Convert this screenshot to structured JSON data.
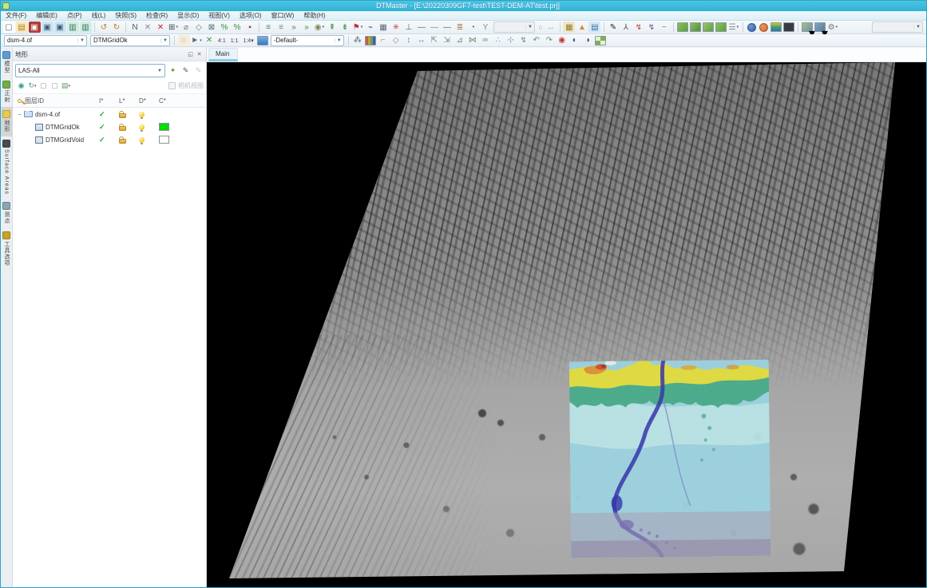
{
  "window": {
    "title": "DTMaster - [E:\\20220309GF7-test\\TEST-DEM-AT\\test.prj]"
  },
  "menus": [
    "文件(F)",
    "编辑(E)",
    "点(P)",
    "线(L)",
    "快照(S)",
    "检查(R)",
    "显示(D)",
    "视图(V)",
    "选项(O)",
    "窗口(W)",
    "帮助(H)"
  ],
  "toolbar1": {
    "icons": [
      {
        "n": "new-file-icon",
        "g": "▢",
        "c": "#666677",
        "bg": "#fdfdfd"
      },
      {
        "n": "open-folder-icon",
        "g": "▤",
        "c": "#a87f28",
        "bg": "#fbe9bc"
      },
      {
        "n": "save-icon",
        "g": "▣",
        "c": "#ffffff",
        "bg": "#b03a3a"
      },
      {
        "n": "copy-view-icon",
        "g": "▣",
        "c": "#33617f",
        "bg": "#cfe3f2"
      },
      {
        "n": "paste-view-icon",
        "g": "▣",
        "c": "#33617f",
        "bg": "#cfe3f2"
      },
      {
        "n": "load-image-icon",
        "g": "▥",
        "c": "#2f6f6f",
        "bg": "#d2eede"
      },
      {
        "n": "load-stereo-icon",
        "g": "▥",
        "c": "#2f6f6f",
        "bg": "#d2eede"
      },
      {
        "t": "sep"
      },
      {
        "n": "undo-icon",
        "g": "↺",
        "c": "#c07820"
      },
      {
        "n": "redo-icon",
        "g": "↻",
        "c": "#c07820"
      },
      {
        "t": "sep"
      },
      {
        "n": "draw-polyline-icon",
        "g": "N",
        "c": "#556"
      },
      {
        "n": "delete-icon",
        "g": "✕",
        "c": "#889"
      },
      {
        "n": "delete-all-icon",
        "g": "✕",
        "c": "#cc2020"
      },
      {
        "n": "grid-select-icon",
        "g": "⊞",
        "c": "#445",
        "dd": true
      },
      {
        "n": "eraser-icon",
        "g": "⌀",
        "c": "#777"
      },
      {
        "n": "clear-region-icon",
        "g": "◇",
        "c": "#777"
      },
      {
        "n": "fence-icon",
        "g": "⊠",
        "c": "#577"
      },
      {
        "n": "interpolate-icon",
        "g": "%",
        "c": "#3a8f3a"
      },
      {
        "n": "interpolate-all-icon",
        "g": "%",
        "c": "#3a8f3a"
      },
      {
        "n": "stop-icon",
        "g": "▪",
        "c": "#c03030"
      },
      {
        "t": "sep"
      },
      {
        "n": "layer-view-icon",
        "g": "≡",
        "c": "#3f7f7f"
      },
      {
        "n": "layer-view-2-icon",
        "g": "≡",
        "c": "#5f8f6f"
      },
      {
        "n": "run-filter-icon",
        "g": "»",
        "c": "#2f8f2f"
      },
      {
        "n": "run-filter-2-icon",
        "g": "»",
        "c": "#2f8f2f"
      },
      {
        "n": "point-tool-icon",
        "g": "◉",
        "c": "#7a8a55",
        "dd": true
      },
      {
        "n": "grow-up-icon",
        "g": "⇞",
        "c": "#3a8f3a"
      },
      {
        "n": "grow-down-icon",
        "g": "⇟",
        "c": "#3a8f3a"
      },
      {
        "n": "flag-tool-icon",
        "g": "⚑",
        "c": "#c03030",
        "dd": true
      },
      {
        "n": "profile-tool-icon",
        "g": "⌁",
        "c": "#567"
      },
      {
        "n": "mesh-tool-icon",
        "g": "▦",
        "c": "#567"
      },
      {
        "n": "spray-tool-icon",
        "g": "✳",
        "c": "#c04040"
      },
      {
        "n": "level-tool-icon",
        "g": "⊥",
        "c": "#567"
      },
      {
        "n": "hline-1-icon",
        "g": "—",
        "c": "#567"
      },
      {
        "n": "hline-2-icon",
        "g": "—",
        "c": "#789"
      },
      {
        "n": "hline-3-icon",
        "g": "—",
        "c": "#567"
      },
      {
        "n": "contour-tool-icon",
        "g": "≣",
        "c": "#b08050"
      },
      {
        "n": "zoom-sector-icon",
        "g": "◔",
        "c": "#567"
      },
      {
        "n": "filter-y-icon",
        "g": "Y",
        "c": "#7a9a5a"
      },
      {
        "t": "combo",
        "n": "value-combo",
        "v": "",
        "w": 52,
        "dis": true
      },
      {
        "t": "text",
        "n": "count-field",
        "v": "0",
        "dis": true
      },
      {
        "n": "fit-width-icon",
        "g": "↔",
        "c": "#aab"
      },
      {
        "t": "sep"
      },
      {
        "n": "palette-grid-icon",
        "g": "▦",
        "c": "#8a7a30",
        "bg": "#efe7c4"
      },
      {
        "n": "warning-icon",
        "g": "▲",
        "c": "#e08820"
      },
      {
        "n": "report-icon",
        "g": "▤",
        "c": "#3a6fa0",
        "bg": "#d8e8f6"
      },
      {
        "t": "sep"
      },
      {
        "n": "pen-black-icon",
        "g": "✎",
        "c": "#222"
      },
      {
        "n": "walk-tool-icon",
        "g": "⅄",
        "c": "#555"
      },
      {
        "n": "route-red-icon",
        "g": "↯",
        "c": "#c04040"
      },
      {
        "n": "route-purple-icon",
        "g": "↯",
        "c": "#884488"
      },
      {
        "n": "curve-tool-icon",
        "g": "~",
        "c": "#777"
      },
      {
        "t": "sep"
      },
      {
        "t": "thumb",
        "n": "ortho-thumb-1-icon",
        "bg": "linear-gradient(135deg,#8cc05a,#5e9e3e)"
      },
      {
        "t": "thumb",
        "n": "ortho-thumb-2-icon",
        "bg": "linear-gradient(135deg,#8cc05a,#4d8e3e)"
      },
      {
        "t": "thumb",
        "n": "ortho-thumb-3-icon",
        "bg": "linear-gradient(135deg,#9cc86a,#5e9e3e)"
      },
      {
        "t": "thumb",
        "n": "ortho-thumb-4-icon",
        "bg": "linear-gradient(135deg,#8cc05a,#5e9e3e)"
      },
      {
        "n": "lines-mode-icon",
        "g": "☰",
        "c": "#888",
        "dd": true
      },
      {
        "t": "sep"
      },
      {
        "t": "dot",
        "n": "globe-blue-icon",
        "bg": "radial-gradient(circle at 35% 35%,#6a9ad8,#2e5fa3)"
      },
      {
        "t": "dot",
        "n": "globe-orange-icon",
        "bg": "radial-gradient(circle at 35% 35%,#e89a5a,#d4622a)"
      },
      {
        "t": "thumb",
        "n": "elevation-palette-icon",
        "bg": "linear-gradient(#e0c030,#40a060,#3070c0)"
      },
      {
        "t": "thumb",
        "n": "shaded-view-icon",
        "bg": "#3a3a42"
      },
      {
        "t": "sep"
      },
      {
        "t": "thumb",
        "n": "image-mode-1-icon",
        "bg": "linear-gradient(135deg,#a8c080,#6a90b0)",
        "dd": true
      },
      {
        "t": "thumb",
        "n": "image-mode-2-icon",
        "bg": "linear-gradient(135deg,#80a8c0,#5a7a9a)",
        "dd": true
      },
      {
        "n": "gear-tool-icon",
        "g": "⚙",
        "c": "#777",
        "dd": true
      },
      {
        "t": "combo",
        "n": "right-combo",
        "v": "",
        "w": 64,
        "dis": true,
        "mla": true
      }
    ]
  },
  "toolbar2": {
    "layer_combo": "dsm-4.of",
    "class_combo": "DTMGridOk",
    "view_combo": "-Default-",
    "icons_mid": [
      {
        "n": "roam-circle-icon",
        "g": "◌",
        "c": "#997744",
        "bg": "#f5ecdc"
      },
      {
        "n": "cursor-mode-icon",
        "g": "►",
        "c": "#667",
        "dd": true
      },
      {
        "n": "snap-cross-icon",
        "g": "✕",
        "c": "#3a9a3a"
      },
      {
        "t": "text",
        "n": "zoom-4-1-button",
        "v": "4:1"
      },
      {
        "t": "text",
        "n": "zoom-1-1-button",
        "v": "1:1"
      },
      {
        "t": "text",
        "n": "zoom-1-4-button",
        "v": "1:4",
        "dd": true
      },
      {
        "t": "thumb",
        "n": "monitor-icon",
        "bg": "linear-gradient(#7ab0e0,#3a79c3)"
      }
    ],
    "icons_after": [
      {
        "n": "point-density-icon",
        "g": "⁂",
        "c": "#567"
      },
      {
        "t": "thumb",
        "n": "histogram-icon",
        "bg": "linear-gradient(90deg,#c06040 0 25%,#c0a040 0 50%,#60a060 0 75%,#4060a0 0 100%)"
      },
      {
        "n": "lock-edit-icon",
        "g": "⌐",
        "c": "#c79020"
      },
      {
        "n": "shield-icon",
        "g": "◇",
        "c": "#888"
      },
      {
        "n": "measure-updown-icon",
        "g": "↕",
        "c": "#6a8a7a"
      },
      {
        "n": "measure-leftright-icon",
        "g": "↔",
        "c": "#6a8a7a"
      },
      {
        "n": "corner-nw-icon",
        "g": "⇱",
        "c": "#6a8a7a"
      },
      {
        "n": "corner-se-icon",
        "g": "⇲",
        "c": "#6a8a7a"
      },
      {
        "n": "slope-icon",
        "g": "⊿",
        "c": "#6a8a7a"
      },
      {
        "n": "join-icon",
        "g": "⋈",
        "c": "#6a8a7a"
      },
      {
        "n": "smooth-icon",
        "g": "≃",
        "c": "#6a8a7a"
      },
      {
        "n": "points-icon",
        "g": "∴",
        "c": "#6a8a7a"
      },
      {
        "n": "cross-points-icon",
        "g": "⊹",
        "c": "#6a8a7a"
      },
      {
        "n": "lightning-icon",
        "g": "↯",
        "c": "#6a8a7a"
      },
      {
        "n": "rotate-left-icon",
        "g": "↶",
        "c": "#6a8a7a"
      },
      {
        "n": "rotate-right-icon",
        "g": "↷",
        "c": "#6a8a7a"
      },
      {
        "n": "target-red-icon",
        "g": "◉",
        "c": "#c03030"
      },
      {
        "n": "orbit-left-icon",
        "g": "◐",
        "c": "#445"
      },
      {
        "n": "orbit-right-icon",
        "g": "◑",
        "c": "#445"
      },
      {
        "t": "thumb",
        "n": "finish-flag-icon",
        "bg": "repeating-conic-gradient(#7ab34d 0 25%,#e8f0d8 0 50%)"
      }
    ]
  },
  "side_tabs": [
    {
      "label": "模型",
      "icon": "model-icon",
      "color": "#5b9bd5",
      "active": false
    },
    {
      "label": "正射",
      "icon": "ortho-icon",
      "color": "#70ad47",
      "active": false
    },
    {
      "label": "地形",
      "icon": "terrain-icon",
      "color": "#e7c94c",
      "active": true
    },
    {
      "label": "Surface Areas",
      "icon": "surface-areas-icon",
      "color": "#4a4a52",
      "active": false
    },
    {
      "label": "测点",
      "icon": "points-panel-icon",
      "color": "#8aa6b0",
      "active": false
    },
    {
      "label": "工具选项",
      "icon": "tool-options-icon",
      "color": "#c9a227",
      "active": false
    }
  ],
  "terrain_panel": {
    "title": "地形",
    "filter_combo": "LAS-All",
    "combo_buttons": [
      {
        "n": "add-filter-button",
        "g": "✦",
        "c": "#6a9a3a"
      },
      {
        "n": "edit-filter-button",
        "g": "✎",
        "c": "#555"
      },
      {
        "n": "delete-filter-button",
        "g": "✎",
        "c": "#c0c6cc"
      }
    ],
    "tool_icons": [
      {
        "n": "binoculars-icon",
        "g": "◉",
        "c": "#2a9a8a"
      },
      {
        "n": "refresh-icon",
        "g": "↻",
        "c": "#4a9a8a",
        "dd": true
      },
      {
        "n": "copy-item-icon",
        "g": "▢",
        "c": "#99a"
      },
      {
        "n": "paste-item-icon",
        "g": "▢",
        "c": "#99a"
      },
      {
        "n": "edit-list-icon",
        "g": "▤",
        "c": "#5a9a5a",
        "dd": true
      }
    ],
    "view_checkbox_label": "相机视图",
    "tree": {
      "name_header": "图层ID",
      "columns": [
        "I*",
        "L*",
        "D*",
        "C*"
      ],
      "rows": [
        {
          "indent": 0,
          "expander": "−",
          "icon": "folder",
          "label": "dsm-4.of",
          "checked": true,
          "unlocked": true,
          "visible": true,
          "color": null
        },
        {
          "indent": 1,
          "expander": "",
          "icon": "grid",
          "label": "DTMGridOk",
          "checked": true,
          "unlocked": true,
          "visible": true,
          "color": "#00dd00"
        },
        {
          "indent": 1,
          "expander": "",
          "icon": "gridvoid",
          "label": "DTMGridVoid",
          "checked": true,
          "unlocked": true,
          "visible": true,
          "color": "#ffffff"
        }
      ]
    }
  },
  "main": {
    "tab_label": "Main"
  },
  "colors": {
    "titlebar": "#2fb2d6",
    "viewport_bg": "#000000",
    "dem_low": "#9ad2e0",
    "dem_mid_green": "#43ab88",
    "dem_high_yellow": "#e3de38",
    "dem_peak_red": "#b02818",
    "dem_river": "#2b2ba8",
    "dem_bottom_band": "#9a90ad",
    "layer_ok_swatch": "#00dd00",
    "layer_void_swatch": "#ffffff"
  }
}
